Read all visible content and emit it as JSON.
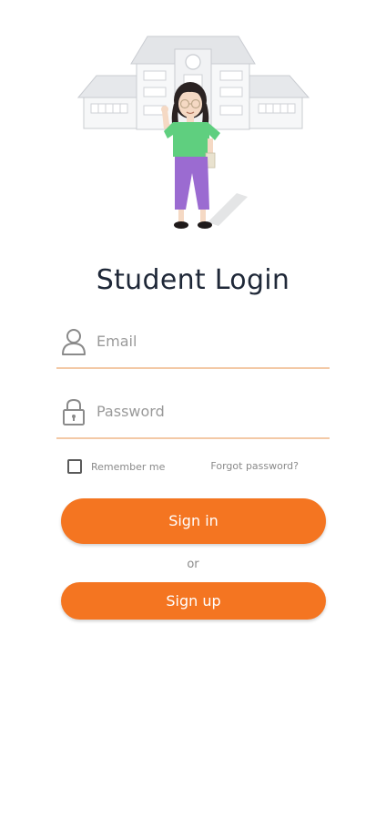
{
  "login": {
    "title": "Student Login",
    "email": {
      "placeholder": "Email",
      "value": "",
      "icon": "user-icon"
    },
    "password": {
      "placeholder": "Password",
      "value": "",
      "icon": "lock-icon"
    },
    "remember_label": "Remember me",
    "remember_checked": false,
    "forgot_label": "Forgot password?",
    "signin_label": "Sign in",
    "or_label": "or",
    "signup_label": "Sign up"
  },
  "colors": {
    "accent": "#f47521",
    "underline": "#f3c9a6",
    "title": "#1f2838",
    "muted": "#8a8a8a"
  }
}
